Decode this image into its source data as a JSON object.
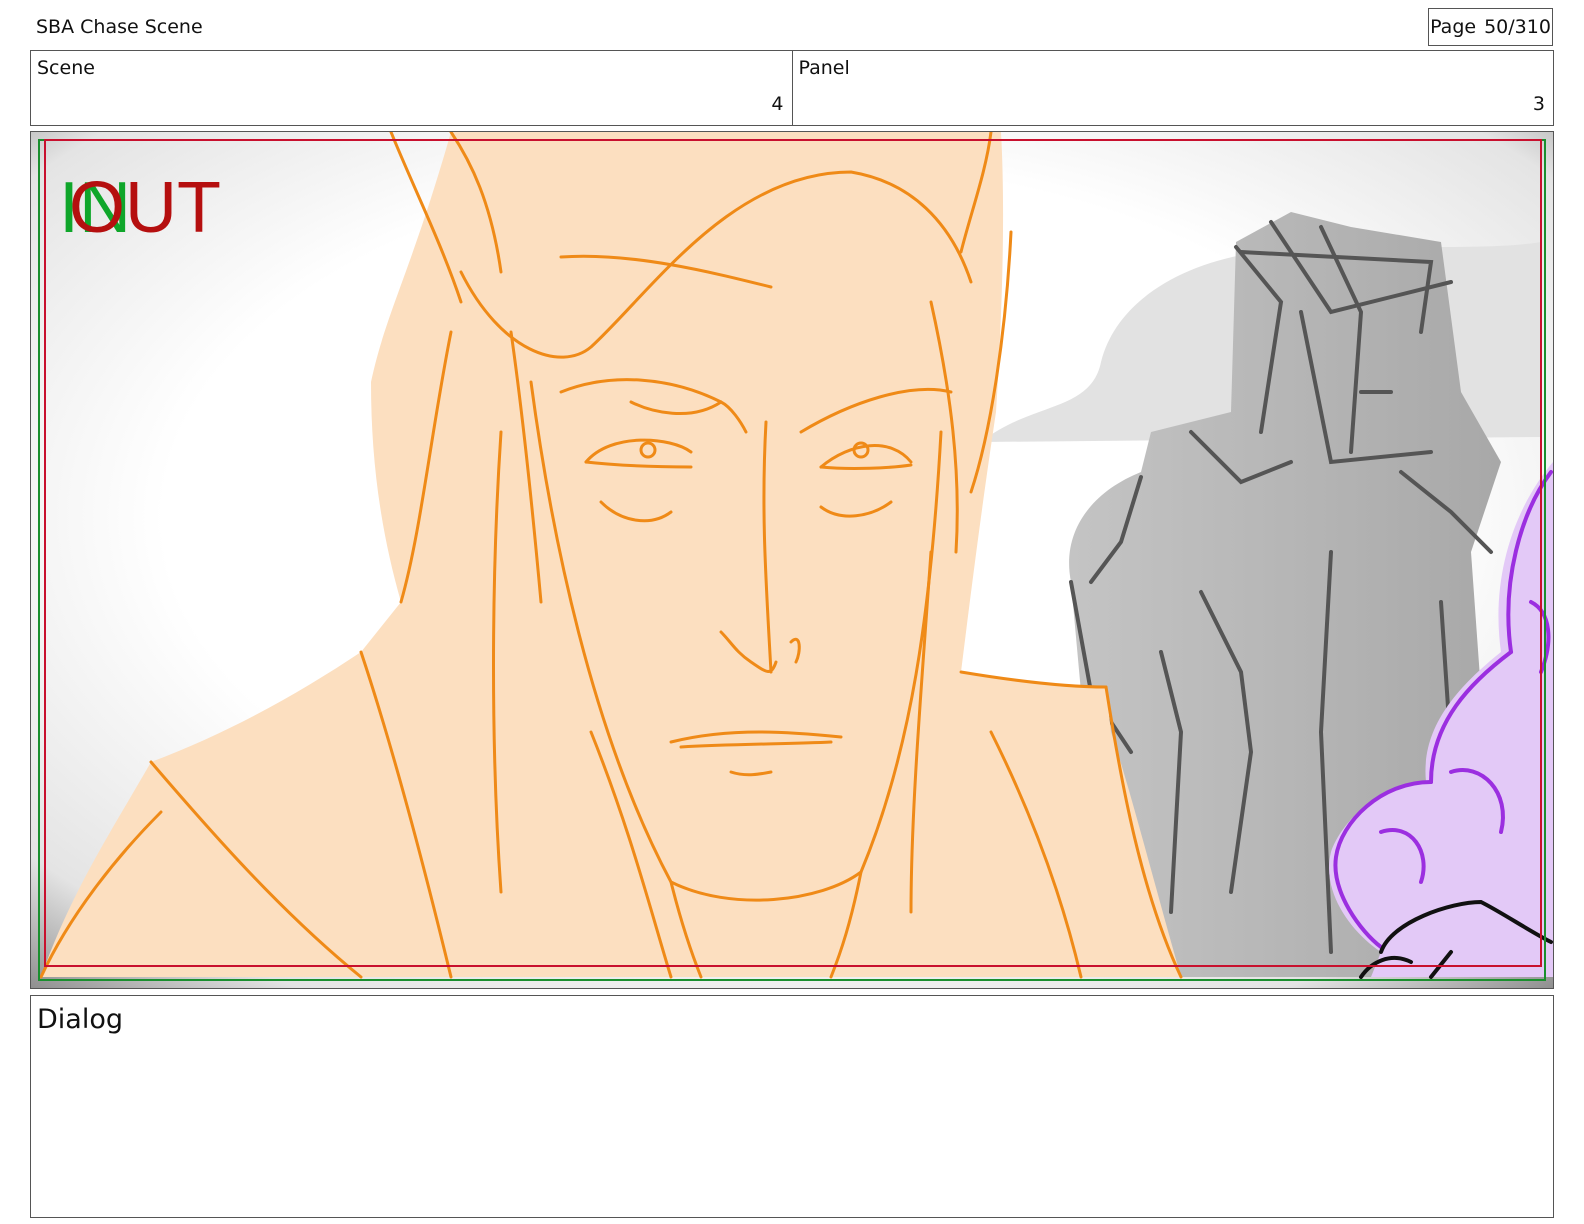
{
  "header": {
    "title": "SBA Chase Scene",
    "page_label": "Page",
    "page_number": "50/310"
  },
  "info": {
    "scene_label": "Scene",
    "scene_value": "4",
    "panel_label": "Panel",
    "panel_value": "3"
  },
  "frame": {
    "overlay_in": "IN",
    "overlay_out": "OUT",
    "colors": {
      "sketch_line": "#ef8a17",
      "sketch_fill": "#fcdfc0",
      "gray_figure": "#bdbdbd",
      "gray_line": "#555555",
      "purple_fill": "#e3c9f7",
      "purple_line": "#9b2fe0",
      "safe_red": "#c8102e",
      "safe_green": "#1a8f2e",
      "overlay_in_green": "#0fa62a",
      "overlay_out_red": "#b50f0f"
    }
  },
  "dialog": {
    "label": "Dialog"
  }
}
